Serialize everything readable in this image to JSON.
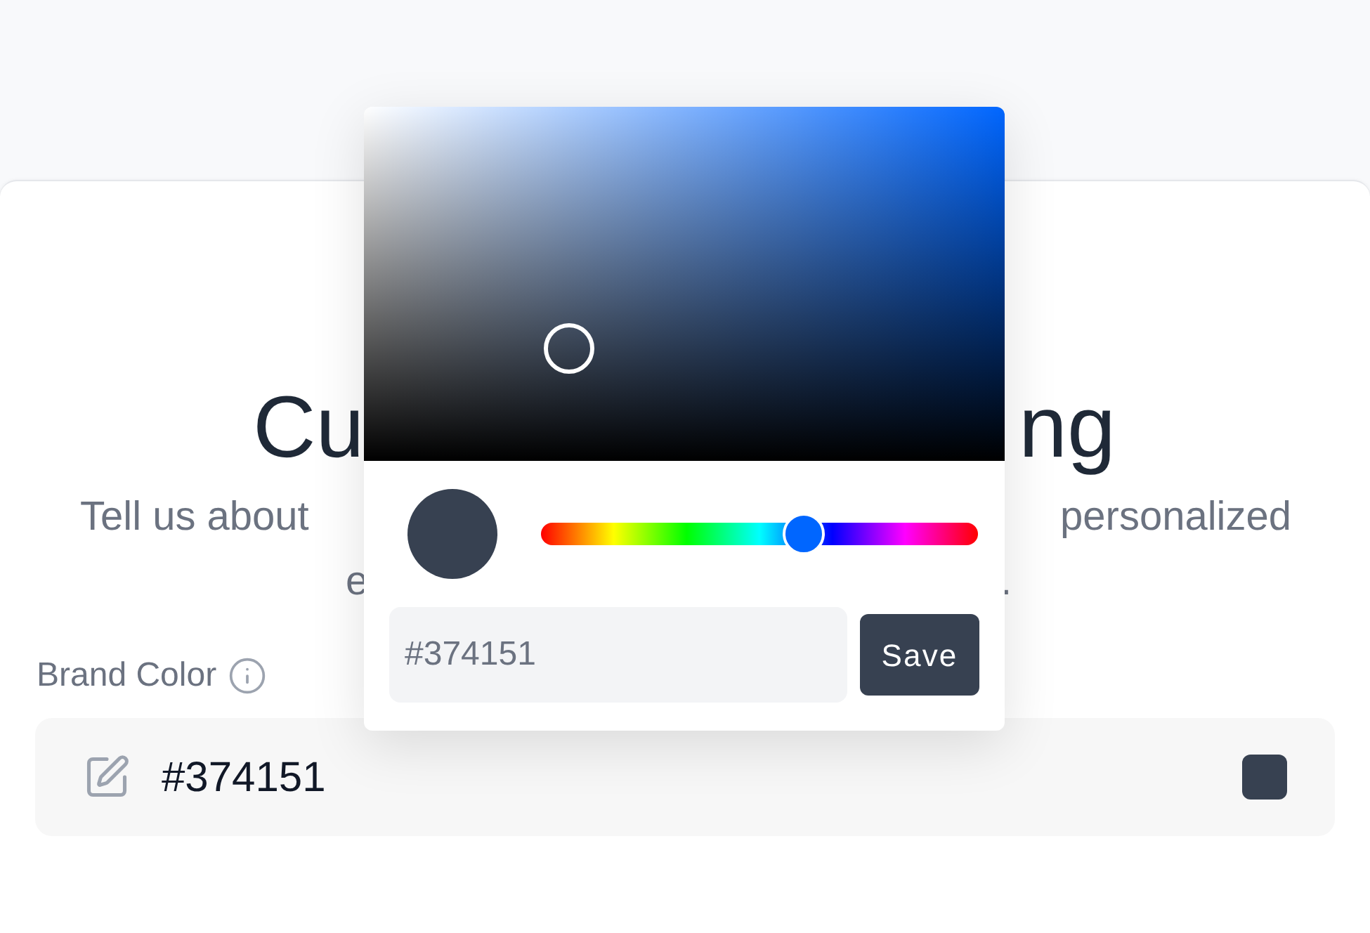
{
  "header": {
    "heading_parts": [
      "Cu",
      "ng"
    ],
    "subtitle_line_1_parts": [
      "Tell us about",
      "personalized"
    ],
    "subtitle_line_2_parts": [
      "e",
      "."
    ]
  },
  "brand_color": {
    "label": "Brand Color",
    "value": "#374151"
  },
  "color_picker": {
    "hue": {
      "level": 0.6
    },
    "hex_input": {
      "value": "#374151"
    },
    "save_button": "Save"
  }
}
